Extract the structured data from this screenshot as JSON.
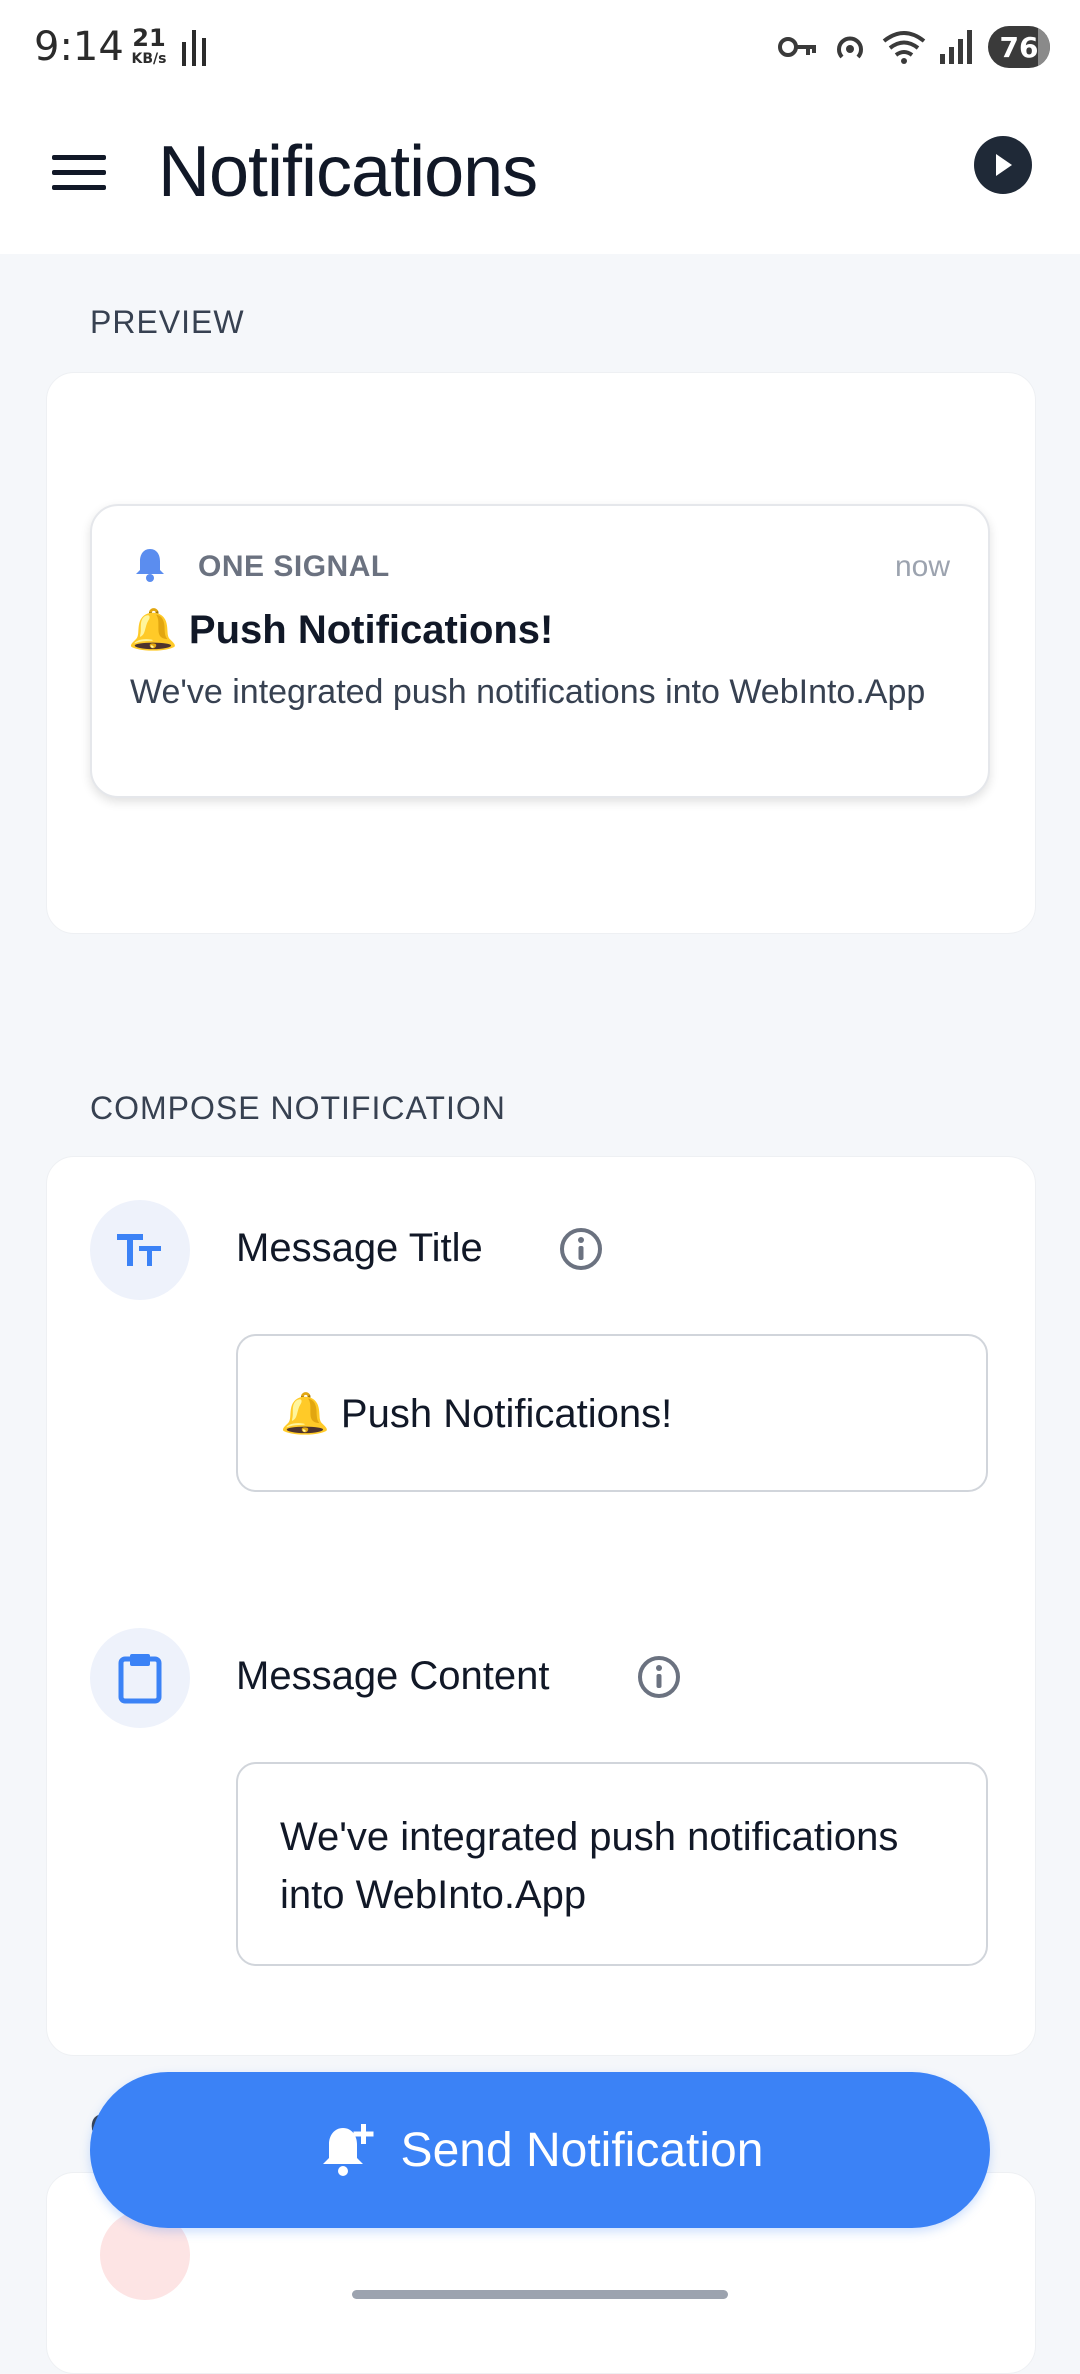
{
  "status_bar": {
    "time": "9:14",
    "net_speed": "21",
    "net_speed_unit": "KB/s",
    "battery": "76"
  },
  "header": {
    "title": "Notifications"
  },
  "preview": {
    "section_label": "PREVIEW",
    "notification": {
      "app_name": "ONE SIGNAL",
      "time": "now",
      "title": "🔔 Push Notifications!",
      "body": "We've integrated push notifications into WebInto.App"
    }
  },
  "compose": {
    "section_label": "COMPOSE NOTIFICATION",
    "title_field": {
      "label": "Message Title",
      "value": "🔔 Push Notifications!"
    },
    "content_field": {
      "label": "Message Content",
      "value": "We've integrated push notifications into WebInto.App"
    }
  },
  "actions": {
    "send_label": "Send Notification"
  },
  "colors": {
    "accent": "#3b82f6",
    "background": "#f5f7fa",
    "card": "#ffffff",
    "text_primary": "#111827"
  },
  "icons": [
    "menu-icon",
    "play-icon",
    "bell-icon",
    "text-size-icon",
    "info-icon",
    "clipboard-icon",
    "bell-plus-icon",
    "key-icon",
    "hotspot-icon",
    "wifi-icon",
    "signal-icon"
  ]
}
